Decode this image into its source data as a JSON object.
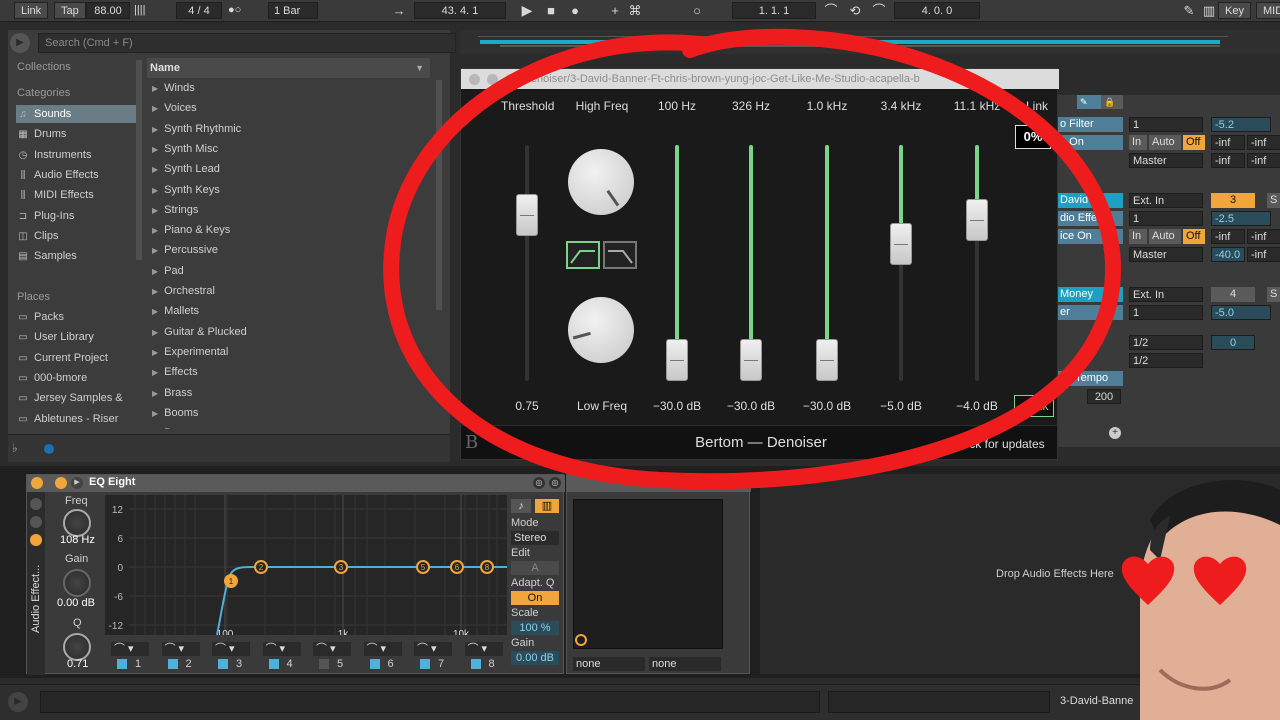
{
  "transport": {
    "link": "Link",
    "tap": "Tap",
    "tempo": "88.00",
    "meter_bars": "||||",
    "signature": "4 / 4",
    "metronome": "●○",
    "quantize": "1 Bar",
    "position": "43.   4.   1",
    "loop_start": "1.   1.   1",
    "loop_length": "4.   0.   0",
    "key": "Key",
    "midi": "MIDI"
  },
  "browser": {
    "search_placeholder": "Search (Cmd + F)",
    "collections_header": "Collections",
    "categories_header": "Categories",
    "categories": [
      "Sounds",
      "Drums",
      "Instruments",
      "Audio Effects",
      "MIDI Effects",
      "Plug-Ins",
      "Clips",
      "Samples"
    ],
    "places_header": "Places",
    "places": [
      "Packs",
      "User Library",
      "Current Project",
      "000-bmore",
      "Jersey Samples &",
      "Abletunes - Riser"
    ],
    "name_header": "Name",
    "items": [
      "Winds",
      "Voices",
      "Synth Rhythmic",
      "Synth Misc",
      "Synth Lead",
      "Synth Keys",
      "Strings",
      "Piano & Keys",
      "Percussive",
      "Pad",
      "Orchestral",
      "Mallets",
      "Guitar & Plucked",
      "Experimental",
      "Effects",
      "Brass",
      "Booms",
      "Bass"
    ]
  },
  "plugin": {
    "window_title": "Denoiser/3-David-Banner-Ft-chris-brown-yung-joc-Get-Like-Me-Studio-acapella-b",
    "labels": {
      "threshold": "Threshold",
      "high_freq": "High Freq",
      "b100": "100 Hz",
      "b326": "326 Hz",
      "b1k": "1.0 kHz",
      "b34k": "3.4 kHz",
      "b111k": "11.1 kHz",
      "link": "Link",
      "low_freq": "Low Freq"
    },
    "values": {
      "threshold": "0.75",
      "b100": "−30.0 dB",
      "b326": "−30.0 dB",
      "b1k": "−30.0 dB",
      "b34k": "−5.0 dB",
      "b111k": "−4.0 dB"
    },
    "slider_levels": {
      "threshold": 0.75,
      "b100": 0.0,
      "b326": 0.0,
      "b1k": 0.0,
      "b34k": 0.6,
      "b111k": 0.72
    },
    "mix_percent": "0%",
    "link_button": "<Link",
    "footer_brand": "Bertom — Denoiser",
    "footer_update": "Check for updates",
    "accent_color": "#7ad48a"
  },
  "mixer": {
    "r1": {
      "input_type": "o Filter",
      "chan": "1",
      "vol": "-5.2"
    },
    "r2": {
      "monitor": "o On",
      "in": "In",
      "auto": "Auto",
      "off": "Off",
      "a": "-inf",
      "b": "-inf"
    },
    "r3": {
      "out": "Master",
      "a": "-inf",
      "b": "-inf"
    },
    "r4": {
      "name": "David-",
      "input": "Ext. In",
      "num": "3",
      "s": "S"
    },
    "r5": {
      "fx": "dio Effect",
      "chan": "1",
      "vol": "-2.5"
    },
    "r6": {
      "monitor": "ice On",
      "in": "In",
      "auto": "Auto",
      "off": "Off",
      "a": "-inf",
      "b": "-inf"
    },
    "r7": {
      "out": "Master",
      "a": "-40.0",
      "b": "-inf"
    },
    "r8": {
      "name": "Money",
      "input": "Ext. In",
      "num": "4",
      "s": "S"
    },
    "r9": {
      "fx": "er",
      "chan": "1",
      "vol": "-5.0"
    },
    "r10": {
      "ratio1": "1/2",
      "zero": "0"
    },
    "r11": {
      "tempo": "ng Tempo",
      "ratio2": "1/2"
    },
    "r12": {
      "val": "200"
    }
  },
  "eq": {
    "title": "EQ Eight",
    "side_label": "Audio Effect...",
    "freq_label": "Freq",
    "freq_value": "108 Hz",
    "gain_label": "Gain",
    "gain_value": "0.00 dB",
    "q_label": "Q",
    "q_value": "0.71",
    "y_ticks": [
      "12",
      "6",
      "0",
      "-6",
      "-12"
    ],
    "x_ticks": [
      "100",
      "1k",
      "10k"
    ],
    "mode_label": "Mode",
    "mode_value": "Stereo",
    "edit_label": "Edit",
    "edit_value": "A",
    "adaptq_label": "Adapt. Q",
    "adaptq_value": "On",
    "scale_label": "Scale",
    "scale_value": "100 %",
    "gain2_label": "Gain",
    "gain2_value": "0.00 dB",
    "bands": [
      "1",
      "2",
      "3",
      "4",
      "5",
      "6",
      "7",
      "8"
    ],
    "nodes": [
      "1",
      "2",
      "3",
      "4",
      "5",
      "6",
      "7",
      "8"
    ]
  },
  "device2": {
    "sel1": "none",
    "sel2": "none"
  },
  "drop_hint": "Drop Audio Effects Here",
  "status": {
    "clip_name": "3-David-Banne"
  },
  "colors": {
    "ableton_orange": "#f0a63a",
    "ableton_cyan": "#1ea0c2",
    "annotation_red": "#ee1c1c"
  }
}
